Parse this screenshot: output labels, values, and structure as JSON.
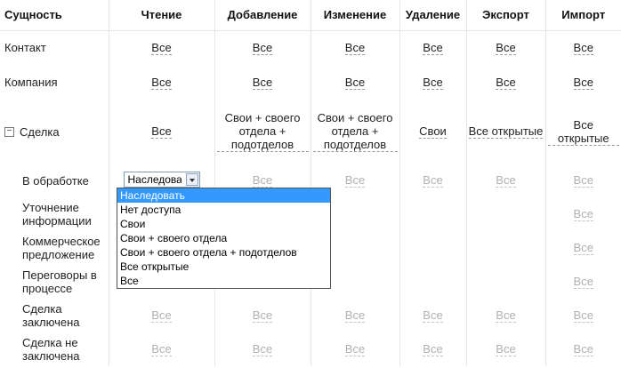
{
  "headers": [
    "Сущность",
    "Чтение",
    "Добавление",
    "Изменение",
    "Удаление",
    "Экспорт",
    "Импорт"
  ],
  "rows": {
    "contact": {
      "label": "Контакт",
      "cells": [
        "Все",
        "Все",
        "Все",
        "Все",
        "Все",
        "Все"
      ]
    },
    "company": {
      "label": "Компания",
      "cells": [
        "Все",
        "Все",
        "Все",
        "Все",
        "Все",
        "Все"
      ]
    },
    "deal": {
      "toggle": "−",
      "label": "Сделка",
      "cells": [
        "Все",
        "Свои + своего отдела + подотделов",
        "Свои + своего отдела + подотделов",
        "Свои",
        "Все открытые",
        "Все открытые"
      ]
    },
    "stages": [
      {
        "label": "В обработке",
        "cells": [
          "",
          "Все",
          "Все",
          "Все",
          "Все",
          "Все"
        ]
      },
      {
        "label": "Уточнение информации",
        "cells": [
          "",
          "",
          "",
          "",
          "",
          "Все"
        ]
      },
      {
        "label": "Коммерческое предложение",
        "cells": [
          "",
          "",
          "",
          "",
          "",
          "Все"
        ]
      },
      {
        "label": "Переговоры в процессе",
        "cells": [
          "",
          "",
          "",
          "",
          "",
          "Все"
        ]
      },
      {
        "label": "Сделка заключена",
        "cells": [
          "Все",
          "Все",
          "Все",
          "Все",
          "Все",
          "Все"
        ]
      },
      {
        "label": "Сделка не заключена",
        "cells": [
          "Все",
          "Все",
          "Все",
          "Все",
          "Все",
          "Все"
        ]
      }
    ]
  },
  "select": {
    "value": "Наследоват"
  },
  "dropdown": {
    "options": [
      "Наследовать",
      "Нет доступа",
      "Свои",
      "Свои + своего отдела",
      "Свои + своего отдела + подотделов",
      "Все открытые",
      "Все"
    ],
    "selected_index": 0
  }
}
